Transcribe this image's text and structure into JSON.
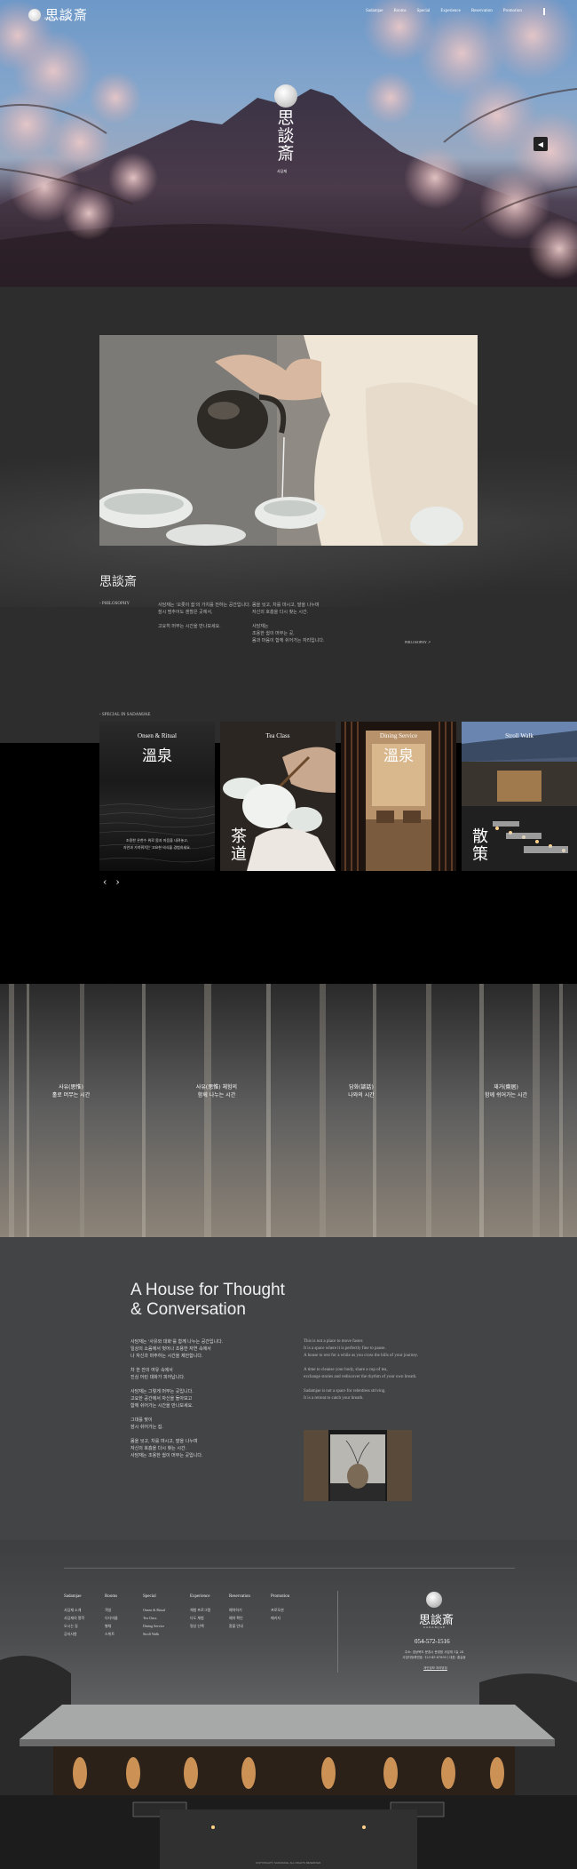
{
  "brand": {
    "name": "思談斎",
    "sub": "SADAMJAE"
  },
  "nav": [
    "Sadamjae",
    "Rooms",
    "Special",
    "Experience",
    "Reservation",
    "Promotion"
  ],
  "hero": {
    "title": "思談斎",
    "subtitle": "사담재",
    "button_icon": "◀"
  },
  "philosophy": {
    "title": "思談斎",
    "label": "- PHILOSOPHY",
    "col1": [
      "사담재는 '오롯이 쉼'의 가치를 전하는 공간입니다.",
      "잠시 멈추어도 괜찮은 곳에서,",
      "",
      "고요히 머무는 시간을 만나보세요."
    ],
    "col2": [
      "몸을 씻고, 차를 마시고, 말을 나누며",
      "자신의 호흡을 다시 찾는 시간.",
      "",
      "사담재는",
      "조용한 쉼이 머무는 곳,",
      "몸과 마음이 함께 쉬어가는 자리입니다."
    ],
    "more": "PHILOSOPHY ↗"
  },
  "special": {
    "label": "- SPECIAL IN SADAMJAE",
    "cards": [
      {
        "title": "Onsen & Ritual",
        "han": "溫泉",
        "desc": [
          "조용한 온천수 위로 몸과 마음을 내려놓고,",
          "자연과 가까워지는 고요한 의식을 경험하세요."
        ]
      },
      {
        "title": "Tea Class",
        "han": "茶道",
        "desc": []
      },
      {
        "title": "Dining Service",
        "han": "溫泉",
        "desc": []
      },
      {
        "title": "Stroll Walk",
        "han": "散策",
        "desc": []
      }
    ],
    "prev": "‹",
    "next": "›"
  },
  "curtain": [
    [
      "사유(思惟)",
      "홀로 머무는 시간"
    ],
    [
      "사유(思惟) 체험의",
      "함께 나누는 시간"
    ],
    [
      "담화(談話)",
      "나와의 시간"
    ],
    [
      "재거(齋居)",
      "함께 쉬어가는 시간"
    ]
  ],
  "house": {
    "title": [
      "A House for Thought",
      "& Conversation"
    ],
    "ko": [
      "사담재는 '사유와 대화'를 함께 나누는 공간입니다.",
      "일상의 소음에서 벗어나 조용한 자연 속에서",
      "나 자신과 마주하는 시간을 제안합니다.",
      "",
      "차 한 잔의 여유 속에서",
      "진심 어린 대화가 피어납니다.",
      "",
      "사담재는 그렇게 머무는 곳입니다.",
      "고요한 공간에서 자신을 돌아보고",
      "함께 쉬어가는 시간을 만나보세요.",
      "",
      "그대를 맞이",
      "잠시 쉬어가는 집.",
      "",
      "몸을 씻고, 차를 마시고, 말을 나누며",
      "자신의 호흡을 다시 찾는 시간.",
      "사담재는 조용한 쉼이 머무는 곳입니다."
    ],
    "en": [
      "This is not a place to move faster.",
      "It is a space where it is perfectly fine to pause.",
      "A house to rest for a while as you cross the hills of your journey.",
      "",
      "A time to cleanse your body, share a cup of tea,",
      "exchange stories and rediscover the rhythm of your own breath.",
      "",
      "Sadamjae is not a space for relentless striving.",
      "It is a retreat to catch your breath."
    ]
  },
  "footer": {
    "cols": [
      {
        "head": "Sadamjae",
        "items": [
          "사담재 소개",
          "사담재의 철학",
          "오시는 길",
          "공지사항"
        ]
      },
      {
        "head": "Rooms",
        "items": [
          "객실",
          "다다미룸",
          "별채",
          "스위트"
        ]
      },
      {
        "head": "Special",
        "items": [
          "Onsen & Ritual",
          "Tea Class",
          "Dining Service",
          "Stroll Walk"
        ]
      },
      {
        "head": "Experience",
        "items": [
          "체험 프로그램",
          "다도 체험",
          "명상 산책"
        ]
      },
      {
        "head": "Reservation",
        "items": [
          "예약하기",
          "예약 확인",
          "환불 안내"
        ]
      },
      {
        "head": "Promotion",
        "items": [
          "프로모션",
          "패키지"
        ]
      }
    ],
    "name": "思談斎",
    "sub": "SADAMJAE",
    "phone": "054-572-1516",
    "addr": [
      "주소: 경상북도 문경시 문경읍 사담재 1길 24",
      "사업자등록번호: 123-45-67890 | 대표: 홍길동"
    ],
    "link": "개인정보 처리방침",
    "copyright": "COPYRIGHT© SADAMJAE. ALL RIGHTS RESERVED."
  }
}
